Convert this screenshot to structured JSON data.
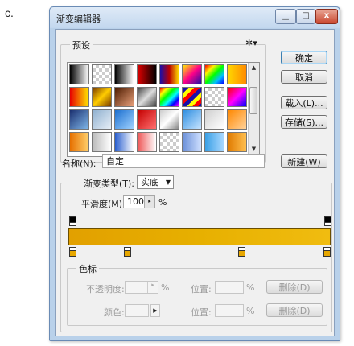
{
  "outer_label": "c.",
  "window": {
    "title": "渐变编辑器",
    "controls": {
      "minimize": "▁",
      "maximize": "□",
      "close": "x"
    }
  },
  "presets": {
    "label": "预设",
    "menu_icon": "gear-icon",
    "swatches": [
      "linear-gradient(90deg,#000,#fff)",
      "repeating-conic-gradient(#ccc 0 25%, #fff 0 50%) 0 0/8px 8px",
      "linear-gradient(90deg,#000,#fff)",
      "linear-gradient(90deg,#e10000,#000)",
      "linear-gradient(90deg,#1a0fa8,#b00,#fcd800)",
      "linear-gradient(135deg,#fff200,#ff0088,#1a0fa8)",
      "linear-gradient(135deg,#ff0000,#fff200,#00ff00,#00c0ff,#0000ff)",
      "linear-gradient(90deg,#ffd800,#ff8a00)",
      "linear-gradient(90deg,#e70000,#ffe400)",
      "linear-gradient(135deg,#7a3b00,#ffcc00,#7a3b00)",
      "linear-gradient(135deg,#4d1b00,#e8a07a)",
      "linear-gradient(135deg,#444,#ddd,#444)",
      "linear-gradient(135deg,#ff0000,#ffff00,#00ff00,#00ffff,#0000ff,#ff00ff)",
      "repeating-linear-gradient(135deg,#1a0fa8 0 5px,#ff0 5px 10px,#f00 10px 15px)",
      "repeating-conic-gradient(#ccc 0 25%, #fff 0 50%) 0 0/8px 8px",
      "linear-gradient(135deg,#ff0000,#ff00ff,#0000ff)",
      "linear-gradient(135deg,#1a2f6f,#7fb6e8)",
      "linear-gradient(135deg,#8fb0cf,#e6eef6)",
      "linear-gradient(135deg,#1c6fcf,#9fd2ff)",
      "linear-gradient(135deg,#c40000,#ff7070)",
      "linear-gradient(135deg,#ccc,#fff,#888)",
      "linear-gradient(135deg,#2e8ee0,#c7e4ff)",
      "linear-gradient(135deg,#d0d0d0,#fff)",
      "linear-gradient(135deg,#ff8800,#ffd29a)",
      "linear-gradient(90deg,#e67000,#ffcf6b)",
      "linear-gradient(90deg,#bbb,#fff)",
      "linear-gradient(90deg,#2a5fcf,#fff)",
      "linear-gradient(90deg,#e55,#fff)",
      "repeating-conic-gradient(#ccc 0 25%, #fff 0 50%) 0 0/8px 8px",
      "linear-gradient(90deg,#6a8fd8,#cfe0ff)",
      "linear-gradient(90deg,#3aa0e6,#a9d8ff)",
      "linear-gradient(90deg,#e07b00,#ffbf50)"
    ]
  },
  "buttons": {
    "ok": "确定",
    "cancel": "取消",
    "load": "载入(L)...",
    "save": "存储(S)...",
    "new": "新建(W)"
  },
  "name": {
    "label": "名称(N):",
    "value": "自定"
  },
  "gradient": {
    "type_label": "渐变类型(T):",
    "type_value": "实底",
    "smooth_label": "平滑度(M):",
    "smooth_value": "100",
    "smooth_unit": "%"
  },
  "color_stops": {
    "label": "色标",
    "opacity_label": "不透明度:",
    "opacity_unit": "%",
    "location_label_1": "位置:",
    "location_unit_1": "%",
    "delete_1": "删除(D)",
    "color_label": "颜色:",
    "location_label_2": "位置:",
    "location_unit_2": "%",
    "delete_2": "删除(D)"
  },
  "colors": {
    "bar_start": "#e2a000",
    "bar_end": "#f0bc10",
    "stop_fill": "#e7a700"
  }
}
